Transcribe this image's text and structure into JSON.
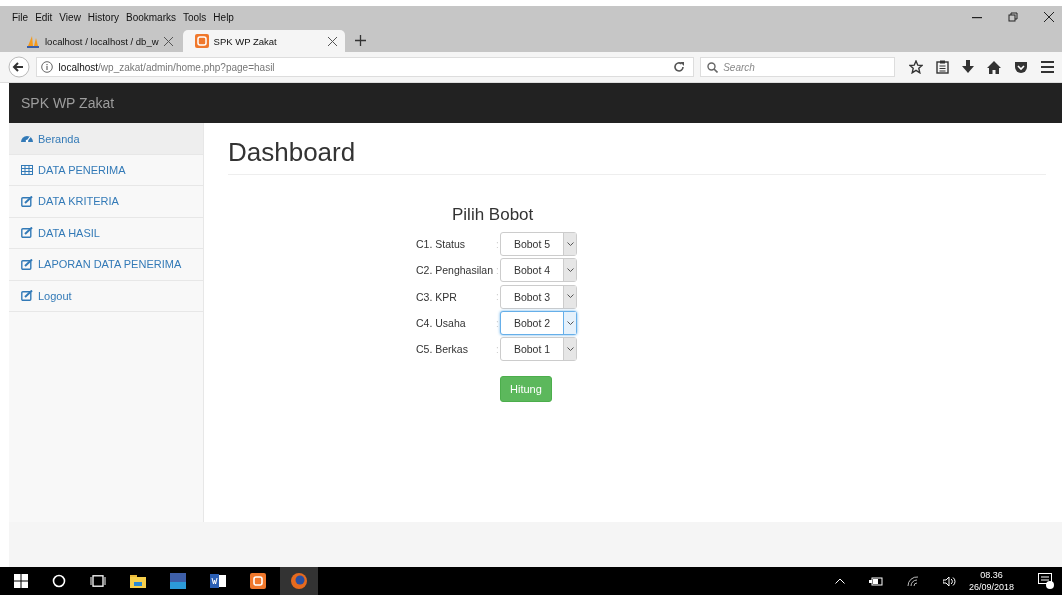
{
  "menu_bar": [
    "File",
    "Edit",
    "View",
    "History",
    "Bookmarks",
    "Tools",
    "Help"
  ],
  "tabs": [
    {
      "title": "localhost / localhost / db_w",
      "selected": false
    },
    {
      "title": "SPK WP Zakat",
      "selected": true
    }
  ],
  "address_bar": {
    "host": "localhost",
    "path": "/wp_zakat/admin/home.php?page=hasil"
  },
  "search": {
    "placeholder": "Search"
  },
  "navbar": {
    "brand": "SPK WP Zakat"
  },
  "sidebar": {
    "items": [
      {
        "label": "Beranda",
        "kind": "dashboard",
        "selected": true
      },
      {
        "label": "DATA PENERIMA",
        "kind": "table",
        "selected": false
      },
      {
        "label": "DATA KRITERIA",
        "kind": "edit",
        "selected": false
      },
      {
        "label": "DATA HASIL",
        "kind": "edit",
        "selected": false
      },
      {
        "label": "LAPORAN DATA PENERIMA",
        "kind": "edit",
        "selected": false
      },
      {
        "label": "Logout",
        "kind": "edit",
        "selected": false
      }
    ]
  },
  "page": {
    "title": "Dashboard",
    "form_title": "Pilih Bobot",
    "criteria": [
      {
        "label": "C1. Status",
        "separator": ":",
        "value": "Bobot 5",
        "focused": false
      },
      {
        "label": "C2. Penghasilan",
        "separator": ":",
        "value": "Bobot 4",
        "focused": false
      },
      {
        "label": "C3. KPR",
        "separator": ":",
        "value": "Bobot 3",
        "focused": false
      },
      {
        "label": "C4. Usaha",
        "separator": ":",
        "value": "Bobot 2",
        "focused": true
      },
      {
        "label": "C5. Berkas",
        "separator": ":",
        "value": "Bobot 1",
        "focused": false
      }
    ],
    "submit": "Hitung"
  },
  "taskbar": {
    "time": "08.36",
    "date": "26/09/2018"
  }
}
